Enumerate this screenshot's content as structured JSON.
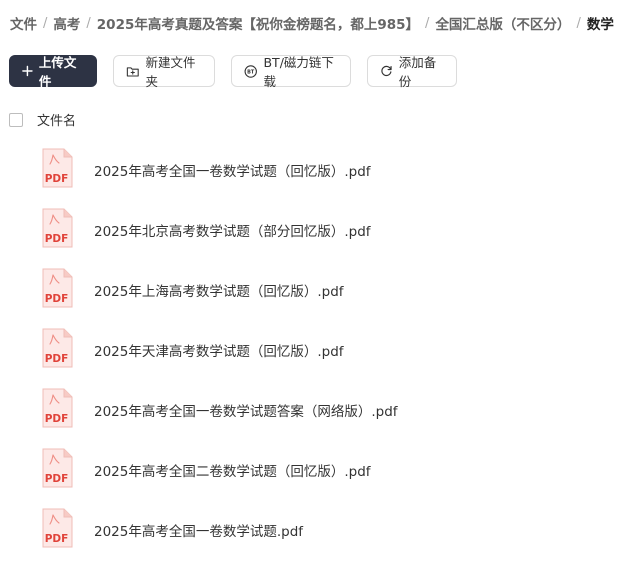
{
  "breadcrumb": [
    {
      "label": "文件"
    },
    {
      "label": "高考"
    },
    {
      "label": "2025年高考真题及答案【祝你金榜题名，都上985】"
    },
    {
      "label": "全国汇总版（不区分）"
    },
    {
      "label": "数学"
    }
  ],
  "toolbar": {
    "upload_label": "上传文件",
    "new_folder_label": "新建文件夹",
    "bt_label": "BT/磁力链下载",
    "backup_label": "添加备份"
  },
  "list": {
    "column_name": "文件名",
    "pdf_badge": "PDF",
    "files": [
      {
        "name": "2025年高考全国一卷数学试题（回忆版）.pdf"
      },
      {
        "name": "2025年北京高考数学试题（部分回忆版）.pdf"
      },
      {
        "name": "2025年上海高考数学试题（回忆版）.pdf"
      },
      {
        "name": "2025年天津高考数学试题（回忆版）.pdf"
      },
      {
        "name": "2025年高考全国一卷数学试题答案（网络版）.pdf"
      },
      {
        "name": "2025年高考全国二卷数学试题（回忆版）.pdf"
      },
      {
        "name": "2025年高考全国一卷数学试题.pdf"
      }
    ]
  },
  "colors": {
    "primary_button": "#2d3344",
    "pdf_red": "#e0433a",
    "pdf_bg": "#fde9e7"
  }
}
